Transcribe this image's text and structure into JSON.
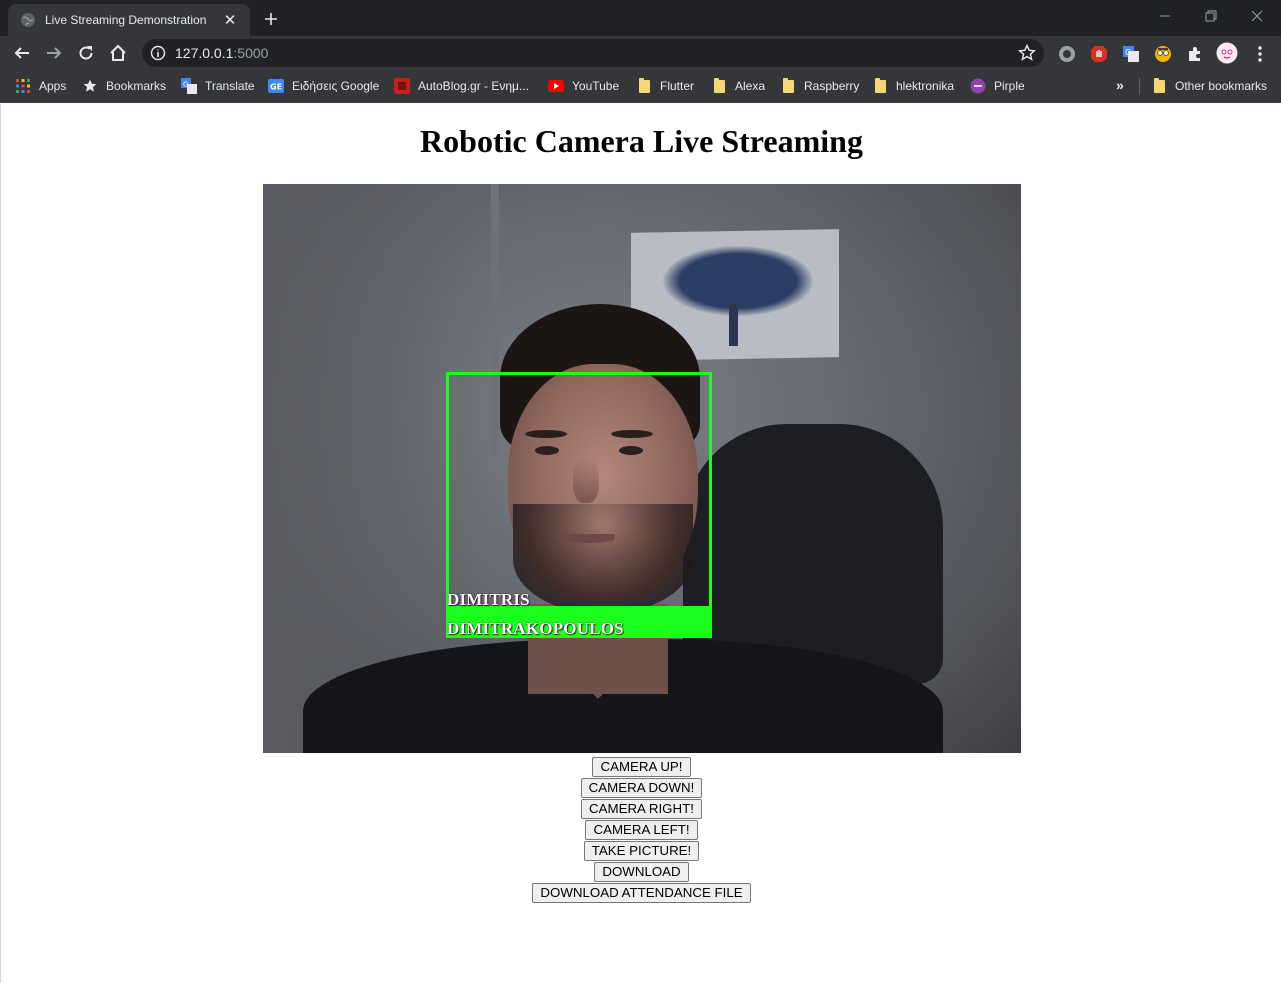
{
  "browser": {
    "tab": {
      "title": "Live Streaming Demonstration",
      "close_glyph": "✕",
      "icon": "globe-icon"
    },
    "new_tab_glyph": "+",
    "window_controls": [
      "minimize",
      "restore",
      "close"
    ],
    "toolbar": {
      "buttons": [
        "back",
        "forward",
        "reload",
        "home"
      ],
      "url_host": "127.0.0.1",
      "url_port": ":5000",
      "info_icon": "info-icon",
      "star_icon": "bookmark-star-icon"
    },
    "extensions": [
      "record-extension-icon",
      "adblock-extension-icon",
      "translate-extension-icon",
      "avatar-extension-icon",
      "puzzle-extensions-icon",
      "profile-avatar-icon",
      "menu-kebab-icon"
    ],
    "bookmarks": [
      {
        "label": "Apps",
        "icon": "apps-grid-icon"
      },
      {
        "label": "Bookmarks",
        "icon": "star-icon"
      },
      {
        "label": "Translate",
        "icon": "translate-icon"
      },
      {
        "label": "Ειδήσεις Google",
        "icon": "google-news-icon"
      },
      {
        "label": "AutoBlog.gr - Ενημ...",
        "icon": "autoblog-icon"
      },
      {
        "label": "YouTube",
        "icon": "youtube-icon"
      },
      {
        "label": "Flutter",
        "icon": "folder-icon"
      },
      {
        "label": "Alexa",
        "icon": "folder-icon"
      },
      {
        "label": "Raspberry",
        "icon": "folder-icon"
      },
      {
        "label": "hlektronika",
        "icon": "folder-icon"
      },
      {
        "label": "Pirple",
        "icon": "pirple-icon"
      }
    ],
    "bookmarks_overflow": "»",
    "other_bookmarks": "Other bookmarks",
    "colors": {
      "frame": "#202124",
      "toolbar": "#35363a",
      "text": "#e8eaed"
    }
  },
  "page": {
    "title": "Robotic Camera Live Streaming",
    "video": {
      "detection_label_line1": "DIMITRIS",
      "detection_label_line2": "DIMITRAKOPOULOS",
      "box_color": "#1cff1c"
    },
    "buttons": {
      "camera_up": "CAMERA UP!",
      "camera_down": "CAMERA DOWN!",
      "camera_right": "CAMERA RIGHT!",
      "camera_left": "CAMERA LEFT!",
      "take_picture": "TAKE PICTURE!",
      "download": "DOWNLOAD",
      "download_attendance": "DOWNLOAD ATTENDANCE FILE"
    }
  }
}
